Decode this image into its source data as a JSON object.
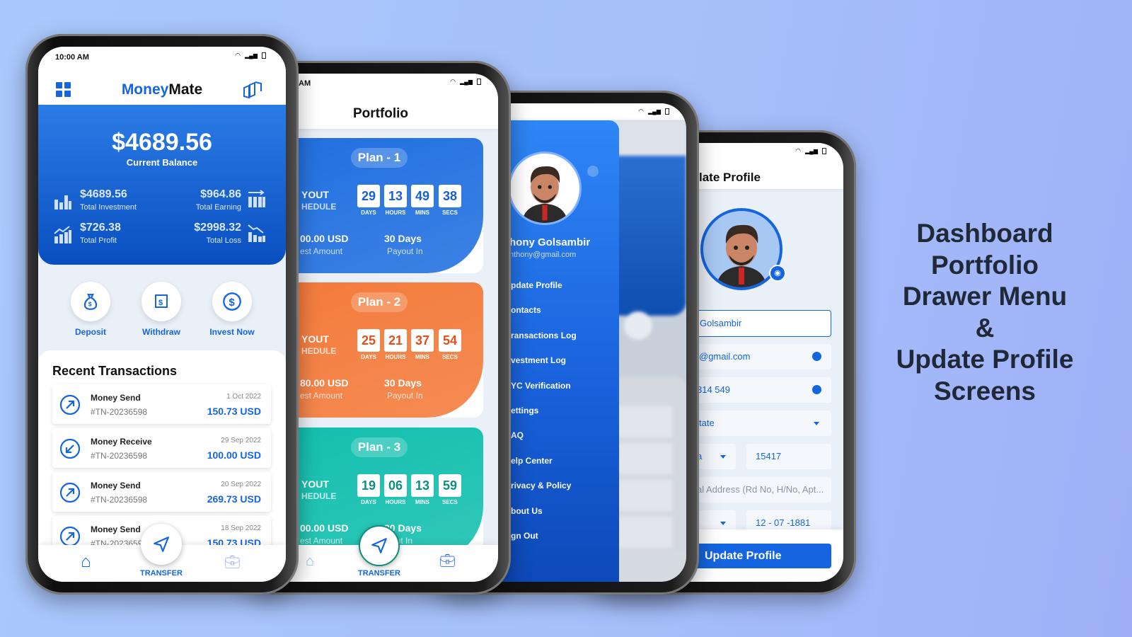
{
  "headline": [
    "Dashboard",
    "Portfolio",
    "Drawer Menu",
    "&",
    "Update Profile",
    "Screens"
  ],
  "colors": {
    "primary": "#1565e0",
    "plan1": "#1f6fe0",
    "plan2": "#f47a3a",
    "plan3": "#12bfae",
    "text_dark": "#1f2937"
  },
  "dashboard": {
    "status_time": "10:00 AM",
    "brand_part1": "Money",
    "brand_part2": "Mate",
    "menu_icon": "grid-icon",
    "balance": "$4689.56",
    "balance_label": "Current Balance",
    "stats": [
      {
        "value": "$4689.56",
        "label": "Total Investment",
        "icon": "bar-chart-icon"
      },
      {
        "value": "$964.86",
        "label": "Total Earning",
        "icon": "earning-chart-icon"
      },
      {
        "value": "$726.38",
        "label": "Total Profit",
        "icon": "profit-chart-icon"
      },
      {
        "value": "$2998.32",
        "label": "Total Loss",
        "icon": "loss-chart-icon"
      }
    ],
    "actions": [
      {
        "label": "Deposit",
        "icon": "money-bag-icon"
      },
      {
        "label": "Withdraw",
        "icon": "receipt-icon"
      },
      {
        "label": "Invest Now",
        "icon": "dollar-circle-icon"
      }
    ],
    "recent_title": "Recent Transactions",
    "transactions": [
      {
        "title": "Money Send",
        "id": "#TN-20236598",
        "date": "1 Oct 2022",
        "amount": "150.73 USD",
        "dir": "out"
      },
      {
        "title": "Money Receive",
        "id": "#TN-20236598",
        "date": "29 Sep 2022",
        "amount": "100.00 USD",
        "dir": "in"
      },
      {
        "title": "Money Send",
        "id": "#TN-20236598",
        "date": "20 Sep 2022",
        "amount": "269.73 USD",
        "dir": "out"
      },
      {
        "title": "Money Send",
        "id": "#TN-20236598",
        "date": "18 Sep 2022",
        "amount": "150.73 USD",
        "dir": "out"
      }
    ],
    "nav_transfer": "TRANSFER"
  },
  "portfolio": {
    "status_time": "AM",
    "title": "Portfolio",
    "countdown_labels": [
      "DAYS",
      "HOURS",
      "MINS",
      "SECS"
    ],
    "plans": [
      {
        "name": "Plan - 1",
        "schedule1": "YOUT",
        "schedule2": "HEDULE",
        "countdown": [
          "29",
          "13",
          "49",
          "38"
        ],
        "amount": "00.00 USD",
        "amount_label": "est Amount",
        "payout": "30 Days",
        "payout_label": "Payout In",
        "color": "#1f6fe0",
        "digit_color": "#1560d8"
      },
      {
        "name": "Plan - 2",
        "schedule1": "YOUT",
        "schedule2": "HEDULE",
        "countdown": [
          "25",
          "21",
          "37",
          "54"
        ],
        "amount": "80.00 USD",
        "amount_label": "est Amount",
        "payout": "30 Days",
        "payout_label": "Payout In",
        "color": "#f47a3a",
        "digit_color": "#e0501a"
      },
      {
        "name": "Plan - 3",
        "schedule1": "YOUT",
        "schedule2": "HEDULE",
        "countdown": [
          "19",
          "06",
          "13",
          "59"
        ],
        "amount": "00.00 USD",
        "amount_label": "est Amount",
        "payout": "30 Days",
        "payout_label": "yout In",
        "color": "#12bfae",
        "digit_color": "#0c8f80"
      }
    ],
    "nav_transfer": "TRANSFER"
  },
  "drawer": {
    "name": "hony Golsambir",
    "email": "nthony@gmail.com",
    "items": [
      "pdate Profile",
      "ontacts",
      "ransactions Log",
      "vestment Log",
      "YC Verification",
      "ettings",
      "AQ",
      "elp Center",
      "rivacy & Policy",
      "bout Us",
      "gn Out"
    ]
  },
  "profile": {
    "title": "late Profile",
    "name_value": "Golsambir",
    "email_value": "@gmail.com",
    "phone_value": "314 549",
    "state_value": "tate",
    "city_value": "a",
    "zip_value": "15417",
    "address_placeholder": "al Address (Rd No, H/No, Apt...",
    "dob_value": "12 - 07 -1881",
    "submit_label": "Update Profile"
  }
}
